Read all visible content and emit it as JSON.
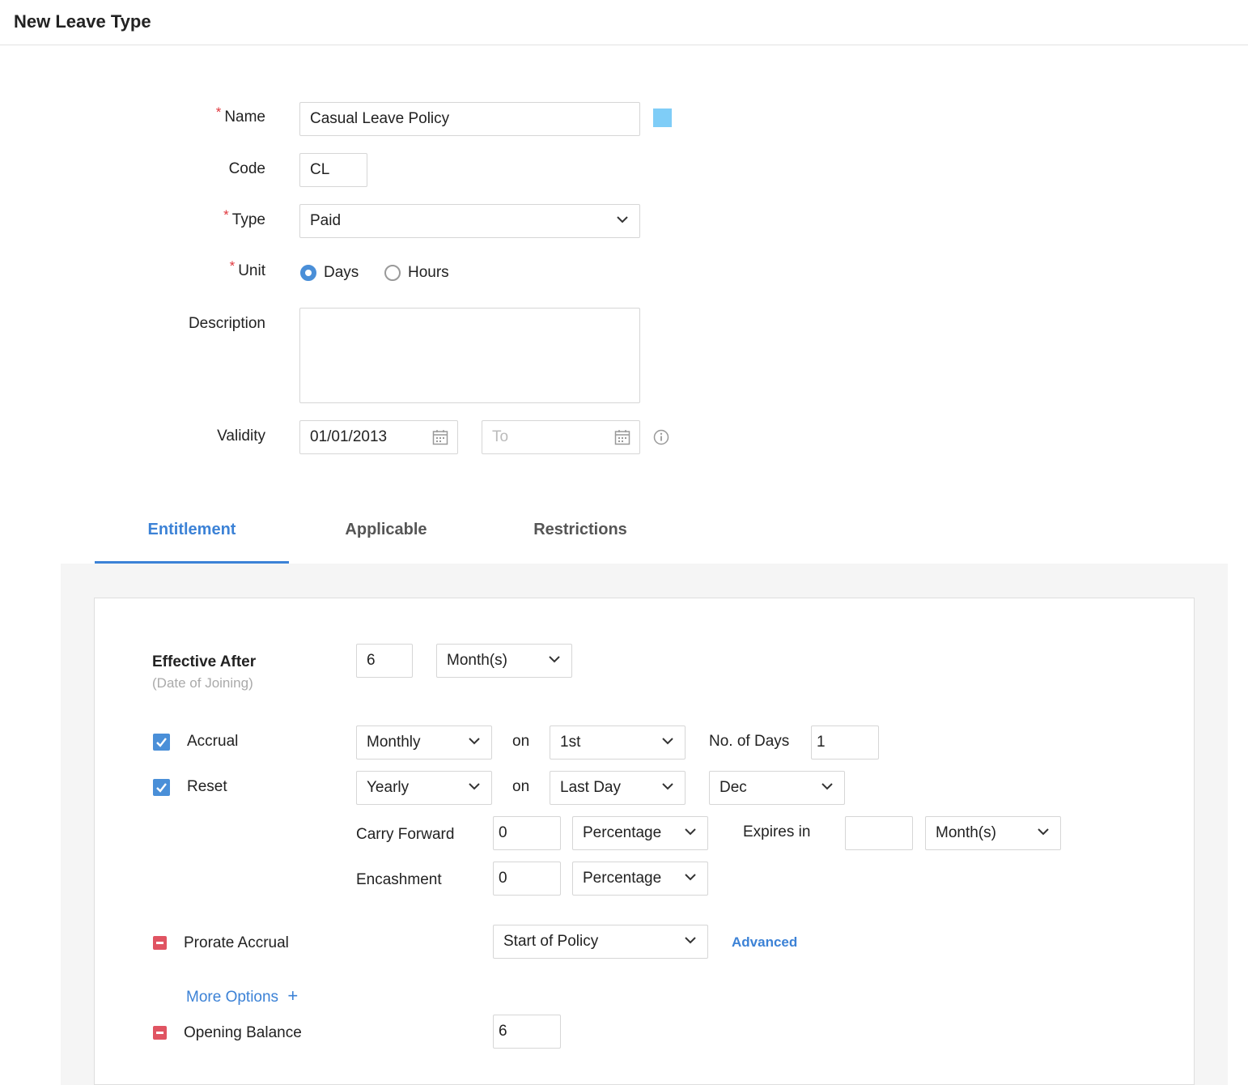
{
  "page": {
    "title": "New Leave Type"
  },
  "form": {
    "name": {
      "label": "Name",
      "value": "Casual Leave Policy",
      "color": "#7fcdf7"
    },
    "code": {
      "label": "Code",
      "value": "CL"
    },
    "type": {
      "label": "Type",
      "value": "Paid"
    },
    "unit": {
      "label": "Unit",
      "options": [
        "Days",
        "Hours"
      ],
      "selected": "Days"
    },
    "description": {
      "label": "Description",
      "value": ""
    },
    "validity": {
      "label": "Validity",
      "from": "01/01/2013",
      "to_placeholder": "To"
    },
    "required_marker": "*"
  },
  "tabs": [
    {
      "label": "Entitlement",
      "active": true
    },
    {
      "label": "Applicable",
      "active": false
    },
    {
      "label": "Restrictions",
      "active": false
    }
  ],
  "entitlement": {
    "effective_after": {
      "label": "Effective After",
      "sublabel": "(Date of Joining)",
      "value": "6",
      "unit": "Month(s)"
    },
    "accrual": {
      "label": "Accrual",
      "checked": true,
      "frequency": "Monthly",
      "on_label": "on",
      "day": "1st",
      "days_label": "No. of Days",
      "days_value": "1"
    },
    "reset": {
      "label": "Reset",
      "checked": true,
      "frequency": "Yearly",
      "on_label": "on",
      "day": "Last Day",
      "month": "Dec"
    },
    "carry_forward": {
      "label": "Carry Forward",
      "value": "0",
      "mode": "Percentage",
      "expires_label": "Expires in",
      "expires_value": "",
      "expires_unit": "Month(s)"
    },
    "encashment": {
      "label": "Encashment",
      "value": "0",
      "mode": "Percentage"
    },
    "prorate_accrual": {
      "label": "Prorate Accrual",
      "value": "Start of Policy",
      "advanced_label": "Advanced"
    },
    "more_options": {
      "label": "More Options",
      "icon": "+"
    },
    "opening_balance": {
      "label": "Opening Balance",
      "value": "6"
    }
  }
}
